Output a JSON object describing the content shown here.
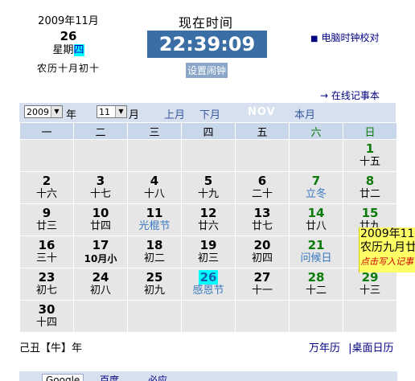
{
  "header": {
    "date_line": "2009年11月",
    "day": "26",
    "weekday_prefix": "星期",
    "weekday_char": "四",
    "lunar": "农历十月初十",
    "now_title": "现在时间",
    "clock": "22:39:09",
    "set_clock": "设置闹钟",
    "sync_link": "电脑时钟校对",
    "notebook_link": "→ 在线记事本"
  },
  "nav": {
    "year_value": "2009",
    "year_suffix": "年",
    "month_value": "11",
    "month_suffix": "月",
    "prev_month": "上月",
    "next_month": "下月",
    "month_abbr": "NOV",
    "this_month": "本月"
  },
  "weekdays": [
    "一",
    "二",
    "三",
    "四",
    "五",
    "六",
    "日"
  ],
  "weeks": [
    [
      null,
      null,
      null,
      null,
      null,
      null,
      {
        "d": "1",
        "l": "十五"
      }
    ],
    [
      {
        "d": "2",
        "l": "十六"
      },
      {
        "d": "3",
        "l": "十七"
      },
      {
        "d": "4",
        "l": "十八"
      },
      {
        "d": "5",
        "l": "十九"
      },
      {
        "d": "6",
        "l": "二十"
      },
      {
        "d": "7",
        "l": "立冬",
        "hol": true
      },
      {
        "d": "8",
        "l": "廿二"
      }
    ],
    [
      {
        "d": "9",
        "l": "廿三"
      },
      {
        "d": "10",
        "l": "廿四"
      },
      {
        "d": "11",
        "l": "光棍节",
        "hol": true
      },
      {
        "d": "12",
        "l": "廿六"
      },
      {
        "d": "13",
        "l": "廿七"
      },
      {
        "d": "14",
        "l": "廿八"
      },
      {
        "d": "15",
        "l": "廿九"
      }
    ],
    [
      {
        "d": "16",
        "l": "三十"
      },
      {
        "d": "17",
        "l": "10月小",
        "small": true
      },
      {
        "d": "18",
        "l": "初二"
      },
      {
        "d": "19",
        "l": "初三"
      },
      {
        "d": "20",
        "l": "初四"
      },
      {
        "d": "21",
        "l": "问候日",
        "hol": true
      },
      {
        "d": "22",
        "l": "初六"
      }
    ],
    [
      {
        "d": "23",
        "l": "初七"
      },
      {
        "d": "24",
        "l": "初八"
      },
      {
        "d": "25",
        "l": "初九"
      },
      {
        "d": "26",
        "l": "感恩节",
        "hol": true,
        "today": true
      },
      {
        "d": "27",
        "l": "十一"
      },
      {
        "d": "28",
        "l": "十二"
      },
      {
        "d": "29",
        "l": "十三"
      }
    ],
    [
      {
        "d": "30",
        "l": "十四"
      },
      null,
      null,
      null,
      null,
      null,
      null
    ]
  ],
  "tooltip": {
    "line1": "2009年11",
    "line2": "农历九月廿",
    "line3": "点击写入记事"
  },
  "footer": {
    "ganzhi": "己丑【牛】年",
    "wannianli": "万年历",
    "desktop_calendar": "|桌面日历"
  },
  "search_tabs": [
    "Google",
    "百度",
    "必应"
  ],
  "colors": {
    "clock_bg": "#3a6ea5",
    "header_bar": "#d6e0ee",
    "weekend": "#0a7a0a",
    "holiday": "#3a78c0",
    "today_highlight": "#00ffff",
    "tooltip_bg": "#ffff66"
  }
}
